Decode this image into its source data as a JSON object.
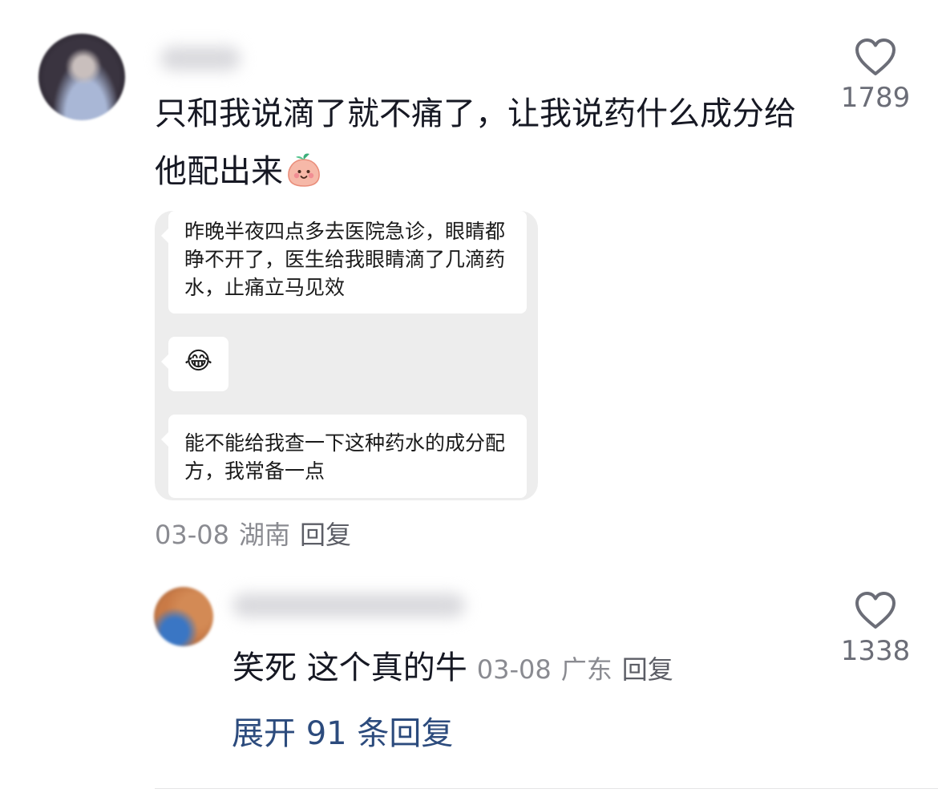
{
  "comment": {
    "text": "只和我说滴了就不痛了，让我说药什么成分给他配出来",
    "emoji": "peach-face-emoji",
    "like_count": "1789",
    "date": "03-08",
    "location": "湖南",
    "reply_label": "回复"
  },
  "chat_screenshot": {
    "messages": [
      {
        "text": "昨晚半夜四点多去医院急诊，眼睛都睁不开了，医生给我眼睛滴了几滴药水，止痛立马见效"
      },
      {
        "text": "😂"
      },
      {
        "text": "能不能给我查一下这种药水的成分配方，我常备一点"
      }
    ],
    "background_color": "#ededed",
    "bubble_color": "#ffffff"
  },
  "reply": {
    "text": "笑死 这个真的牛",
    "date": "03-08",
    "location": "广东",
    "reply_label": "回复",
    "like_count": "1338"
  },
  "expand_label": "展开 91 条回复",
  "colors": {
    "primary_text": "#161823",
    "secondary_text": "#8a8b91",
    "link": "#2c4b7d"
  },
  "icons": {
    "like": "heart-outline-icon"
  }
}
